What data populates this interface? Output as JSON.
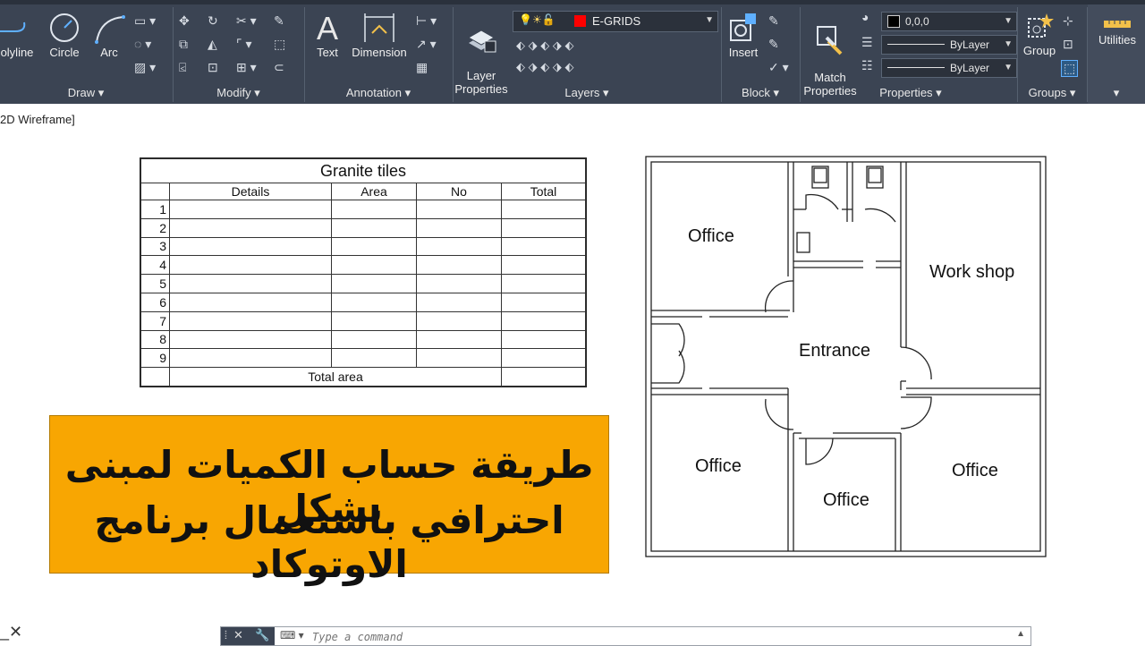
{
  "ribbon": {
    "draw_panel": {
      "title": "Draw",
      "tools": [
        "olyline",
        "Circle",
        "Arc"
      ]
    },
    "modify_panel": {
      "title": "Modify"
    },
    "annotation_panel": {
      "title": "Annotation",
      "tools": [
        "Text",
        "Dimension"
      ]
    },
    "layers_panel": {
      "title": "Layers",
      "tools": [
        "Layer\nProperties"
      ],
      "current_layer": "E-GRIDS",
      "layer_color": "#ff0000"
    },
    "block_panel": {
      "title": "Block",
      "tools": [
        "Insert"
      ]
    },
    "properties_panel": {
      "title": "Properties",
      "tools": [
        "Match\nProperties"
      ],
      "color_value": "0,0,0",
      "linetype": "ByLayer",
      "lineweight": "ByLayer"
    },
    "groups_panel": {
      "title": "Groups",
      "tools": [
        "Group"
      ]
    },
    "utilities_panel": {
      "title": "Utilities"
    }
  },
  "viewport": {
    "label": "2D Wireframe]"
  },
  "tile_table": {
    "title": "Granite tiles",
    "headers": [
      "Details",
      "Area",
      "No",
      "Total"
    ],
    "row_numbers": [
      "1",
      "2",
      "3",
      "4",
      "5",
      "6",
      "7",
      "8",
      "9"
    ],
    "footer": "Total area"
  },
  "banner": {
    "line1": "طريقة حساب الكميات لمبنى بشكل",
    "line2": "احترافي باستعمال برنامج الاوتوكاد",
    "color": "#f8a602"
  },
  "floor_plan": {
    "rooms": {
      "office_top_left": "Office",
      "workshop": "Work shop",
      "entrance": "Entrance",
      "office_bottom_left": "Office",
      "office_bottom_middle": "Office",
      "office_bottom_right": "Office"
    }
  },
  "command_line": {
    "placeholder": "Type a command"
  },
  "icons": [
    "polyline-icon",
    "circle-icon",
    "arc-icon",
    "move-icon",
    "rotate-icon",
    "trim-icon",
    "text-icon",
    "dimension-icon",
    "layer-properties-icon",
    "insert-block-icon",
    "match-properties-icon",
    "group-icon",
    "utilities-icon",
    "close-icon",
    "wrench-icon",
    "terminal-icon"
  ]
}
